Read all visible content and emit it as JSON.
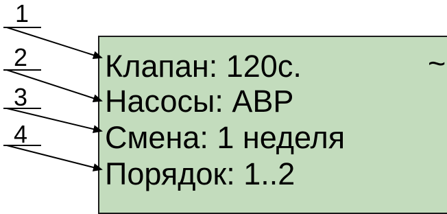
{
  "display": {
    "background_color": "#c3dcbd",
    "indicator": "~",
    "lines": [
      "Клапан: 120с.",
      "Насосы: АВР",
      "Смена: 1 неделя",
      "Порядок: 1..2"
    ]
  },
  "callouts": [
    "1",
    "2",
    "3",
    "4"
  ]
}
